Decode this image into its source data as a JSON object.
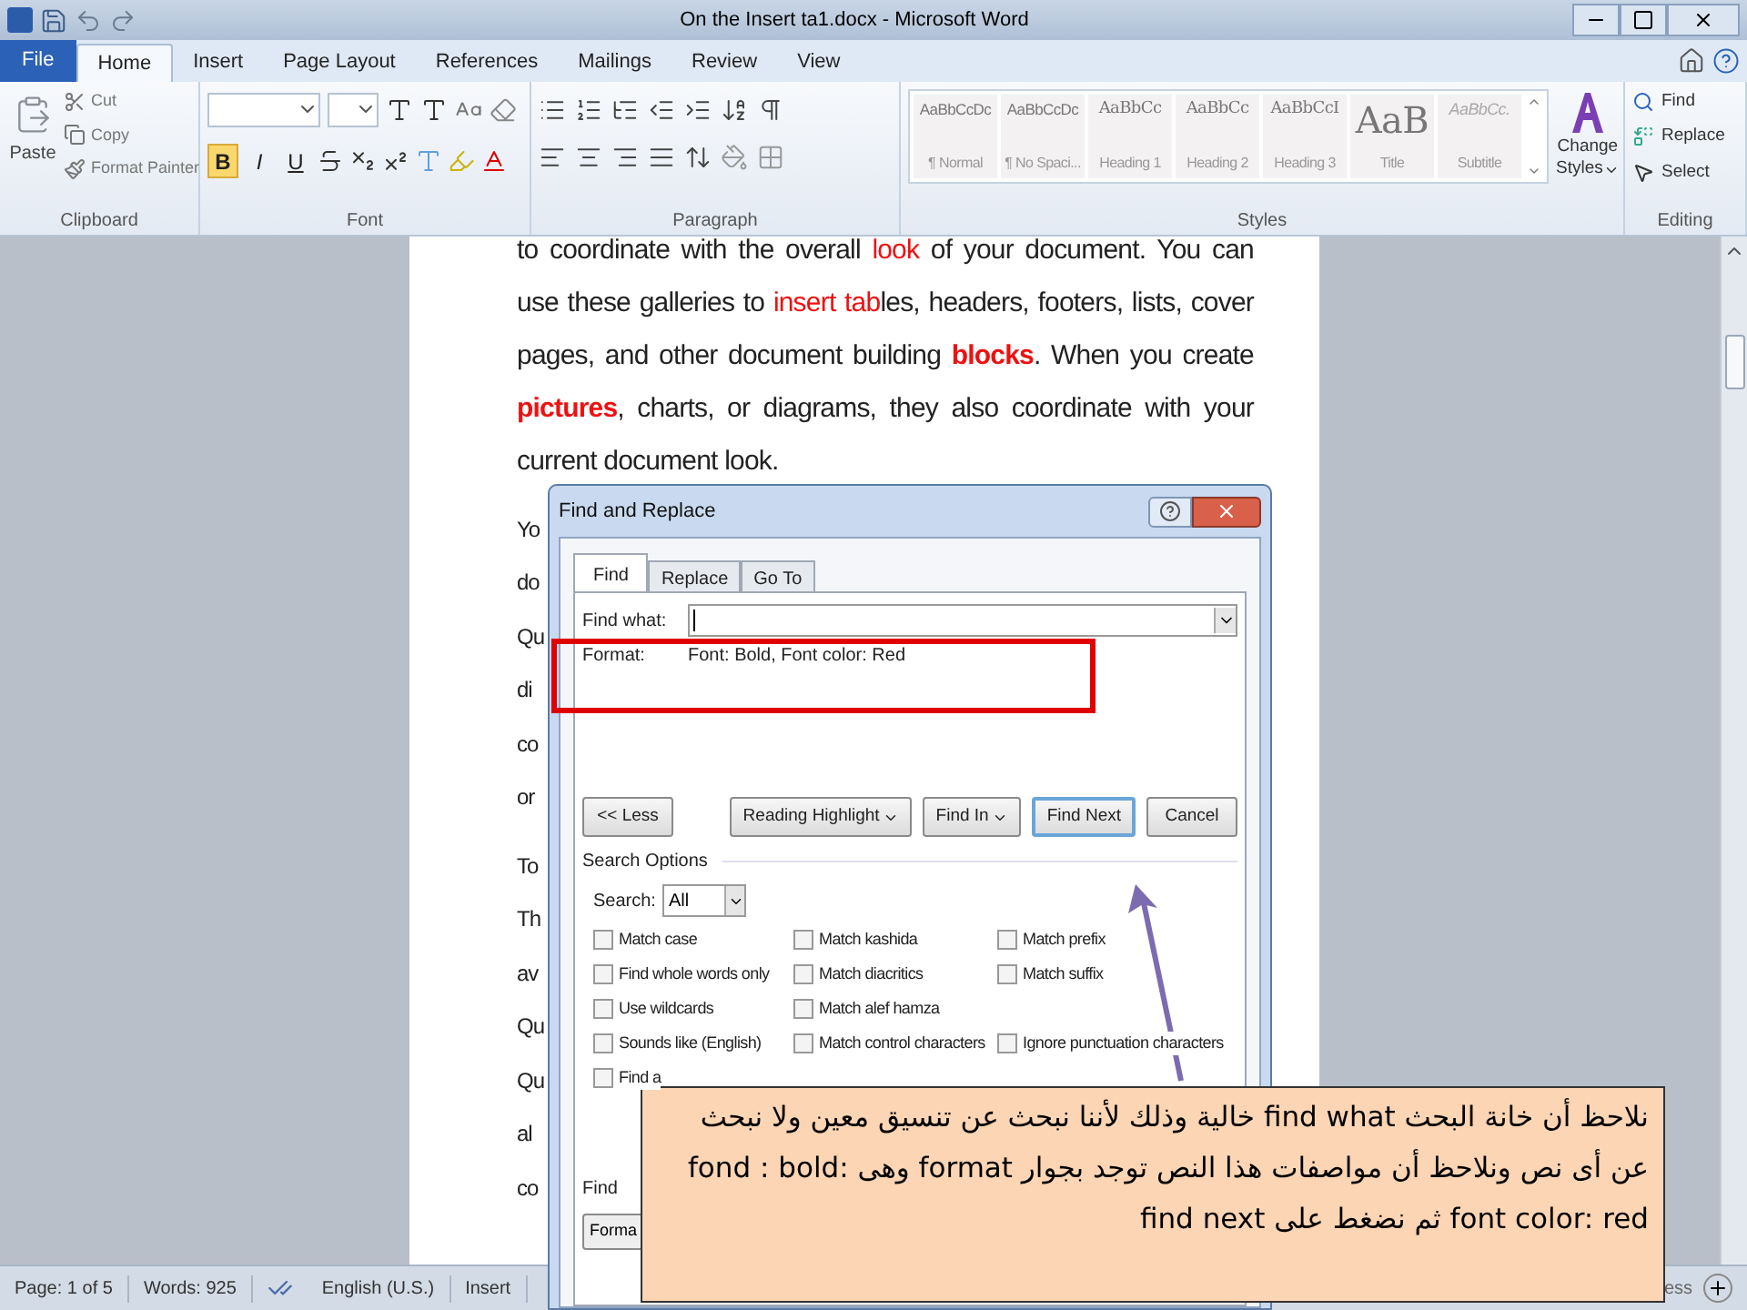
{
  "window": {
    "title": "On the Insert ta1.docx - Microsoft Word"
  },
  "ribbon_tabs": [
    {
      "label": "File",
      "kind": "file",
      "selected": false
    },
    {
      "label": "Home",
      "kind": "tab",
      "selected": true
    },
    {
      "label": "Insert",
      "kind": "tab",
      "selected": false
    },
    {
      "label": "Page Layout",
      "kind": "tab",
      "selected": false
    },
    {
      "label": "References",
      "kind": "tab",
      "selected": false
    },
    {
      "label": "Mailings",
      "kind": "tab",
      "selected": false
    },
    {
      "label": "Review",
      "kind": "tab",
      "selected": false
    },
    {
      "label": "View",
      "kind": "tab",
      "selected": false
    }
  ],
  "clipboard": {
    "paste": "Paste",
    "cut": "Cut",
    "copy": "Copy",
    "format_painter": "Format Painter",
    "label": "Clipboard"
  },
  "font_group": {
    "label": "Font",
    "buttons": [
      {
        "label": "B",
        "selected": true
      },
      {
        "label": "I",
        "selected": false
      },
      {
        "label": "U",
        "selected": false
      }
    ]
  },
  "paragraph_group": {
    "label": "Paragraph"
  },
  "styles": {
    "label": "Styles",
    "items": [
      {
        "preview": "AaBbCcDc",
        "name": "¶ Normal",
        "kind": "plain"
      },
      {
        "preview": "AaBbCcDc",
        "name": "¶ No Spaci...",
        "kind": "plain"
      },
      {
        "preview": "AaBbCc",
        "name": "Heading 1",
        "kind": "heading"
      },
      {
        "preview": "AaBbCc",
        "name": "Heading 2",
        "kind": "heading"
      },
      {
        "preview": "AaBbCcI",
        "name": "Heading 3",
        "kind": "heading"
      },
      {
        "preview": "AaB",
        "name": "Title",
        "kind": "title"
      },
      {
        "preview": "AaBbCc.",
        "name": "Subtitle",
        "kind": "subtitle"
      }
    ],
    "change_styles": [
      "Change",
      "Styles"
    ]
  },
  "editing": {
    "label": "Editing",
    "find": "Find",
    "replace": "Replace",
    "select": "Select"
  },
  "document": {
    "paragraph": [
      {
        "text": "to coordinate with the overall ",
        "red": false,
        "bold": false
      },
      {
        "text": "look",
        "red": true,
        "bold": false
      },
      {
        "text": " of your document. You can use these galleries to ",
        "red": false,
        "bold": false
      },
      {
        "text": "insert tab",
        "red": true,
        "bold": false
      },
      {
        "text": "les, headers, footers, lists, cover pages, and other document building ",
        "red": false,
        "bold": false
      },
      {
        "text": "blocks",
        "red": true,
        "bold": true
      },
      {
        "text": ". When you create ",
        "red": false,
        "bold": false
      },
      {
        "text": "pictures",
        "red": true,
        "bold": true
      },
      {
        "text": ", charts, or diagrams, they also coordinate with your current document look.",
        "red": false,
        "bold": false
      }
    ],
    "fragments_1": [
      "Yo",
      "do",
      "Qu",
      "di",
      "co",
      "or"
    ],
    "fragments_2": [
      "To",
      "Th",
      "av",
      "Qu",
      "Qu",
      "al",
      "co"
    ]
  },
  "dialog": {
    "title": "Find and Replace",
    "tabs": [
      {
        "label": "Find",
        "selected": true
      },
      {
        "label": "Replace",
        "selected": false
      },
      {
        "label": "Go To",
        "selected": false
      }
    ],
    "find_what_label": "Find what:",
    "format_label": "Format:",
    "format_value": "Font: Bold, Font color: Red",
    "buttons": [
      {
        "label": "<< Less",
        "kind": "plain",
        "default": false
      },
      {
        "label": "Reading Highlight",
        "kind": "menu",
        "default": false
      },
      {
        "label": "Find In",
        "kind": "menu",
        "default": false
      },
      {
        "label": "Find Next",
        "kind": "plain",
        "default": true
      },
      {
        "label": "Cancel",
        "kind": "plain",
        "default": false
      }
    ],
    "search_options_label": "Search Options",
    "search_label": "Search:",
    "search_value": "All",
    "options": [
      [
        {
          "label": "Match case",
          "checked": false
        },
        {
          "label": "Find whole words only",
          "checked": false
        },
        {
          "label": "Use wildcards",
          "checked": false
        },
        {
          "label": "Sounds like (English)",
          "checked": false
        },
        {
          "label": "Find a",
          "checked": false
        }
      ],
      [
        {
          "label": "Match kashida",
          "checked": false
        },
        {
          "label": "Match diacritics",
          "checked": false
        },
        {
          "label": "Match alef hamza",
          "checked": false
        },
        {
          "label": "Match control characters",
          "checked": false
        }
      ],
      [
        {
          "label": "Match prefix",
          "checked": false
        },
        {
          "label": "Match suffix",
          "checked": false
        },
        {
          "label": "Ignore punctuation characters",
          "checked": false
        }
      ]
    ],
    "find_label": "Find",
    "format_button": "Forma"
  },
  "callout": {
    "text": "نلاحظ أن خانة البحث find what خالية وذلك لأننا نبحث عن تنسيق معين ولا نبحث عن أى نص  ونلاحظ أن مواصفات هذا النص توجد بجوار format وهى fond : bold: font color: red ثم نضغط على find next"
  },
  "status_bar": {
    "page": "Page: 1 of 5",
    "words": "Words: 925",
    "language": "English (U.S.)",
    "mode": "Insert",
    "fragment": "ess"
  }
}
